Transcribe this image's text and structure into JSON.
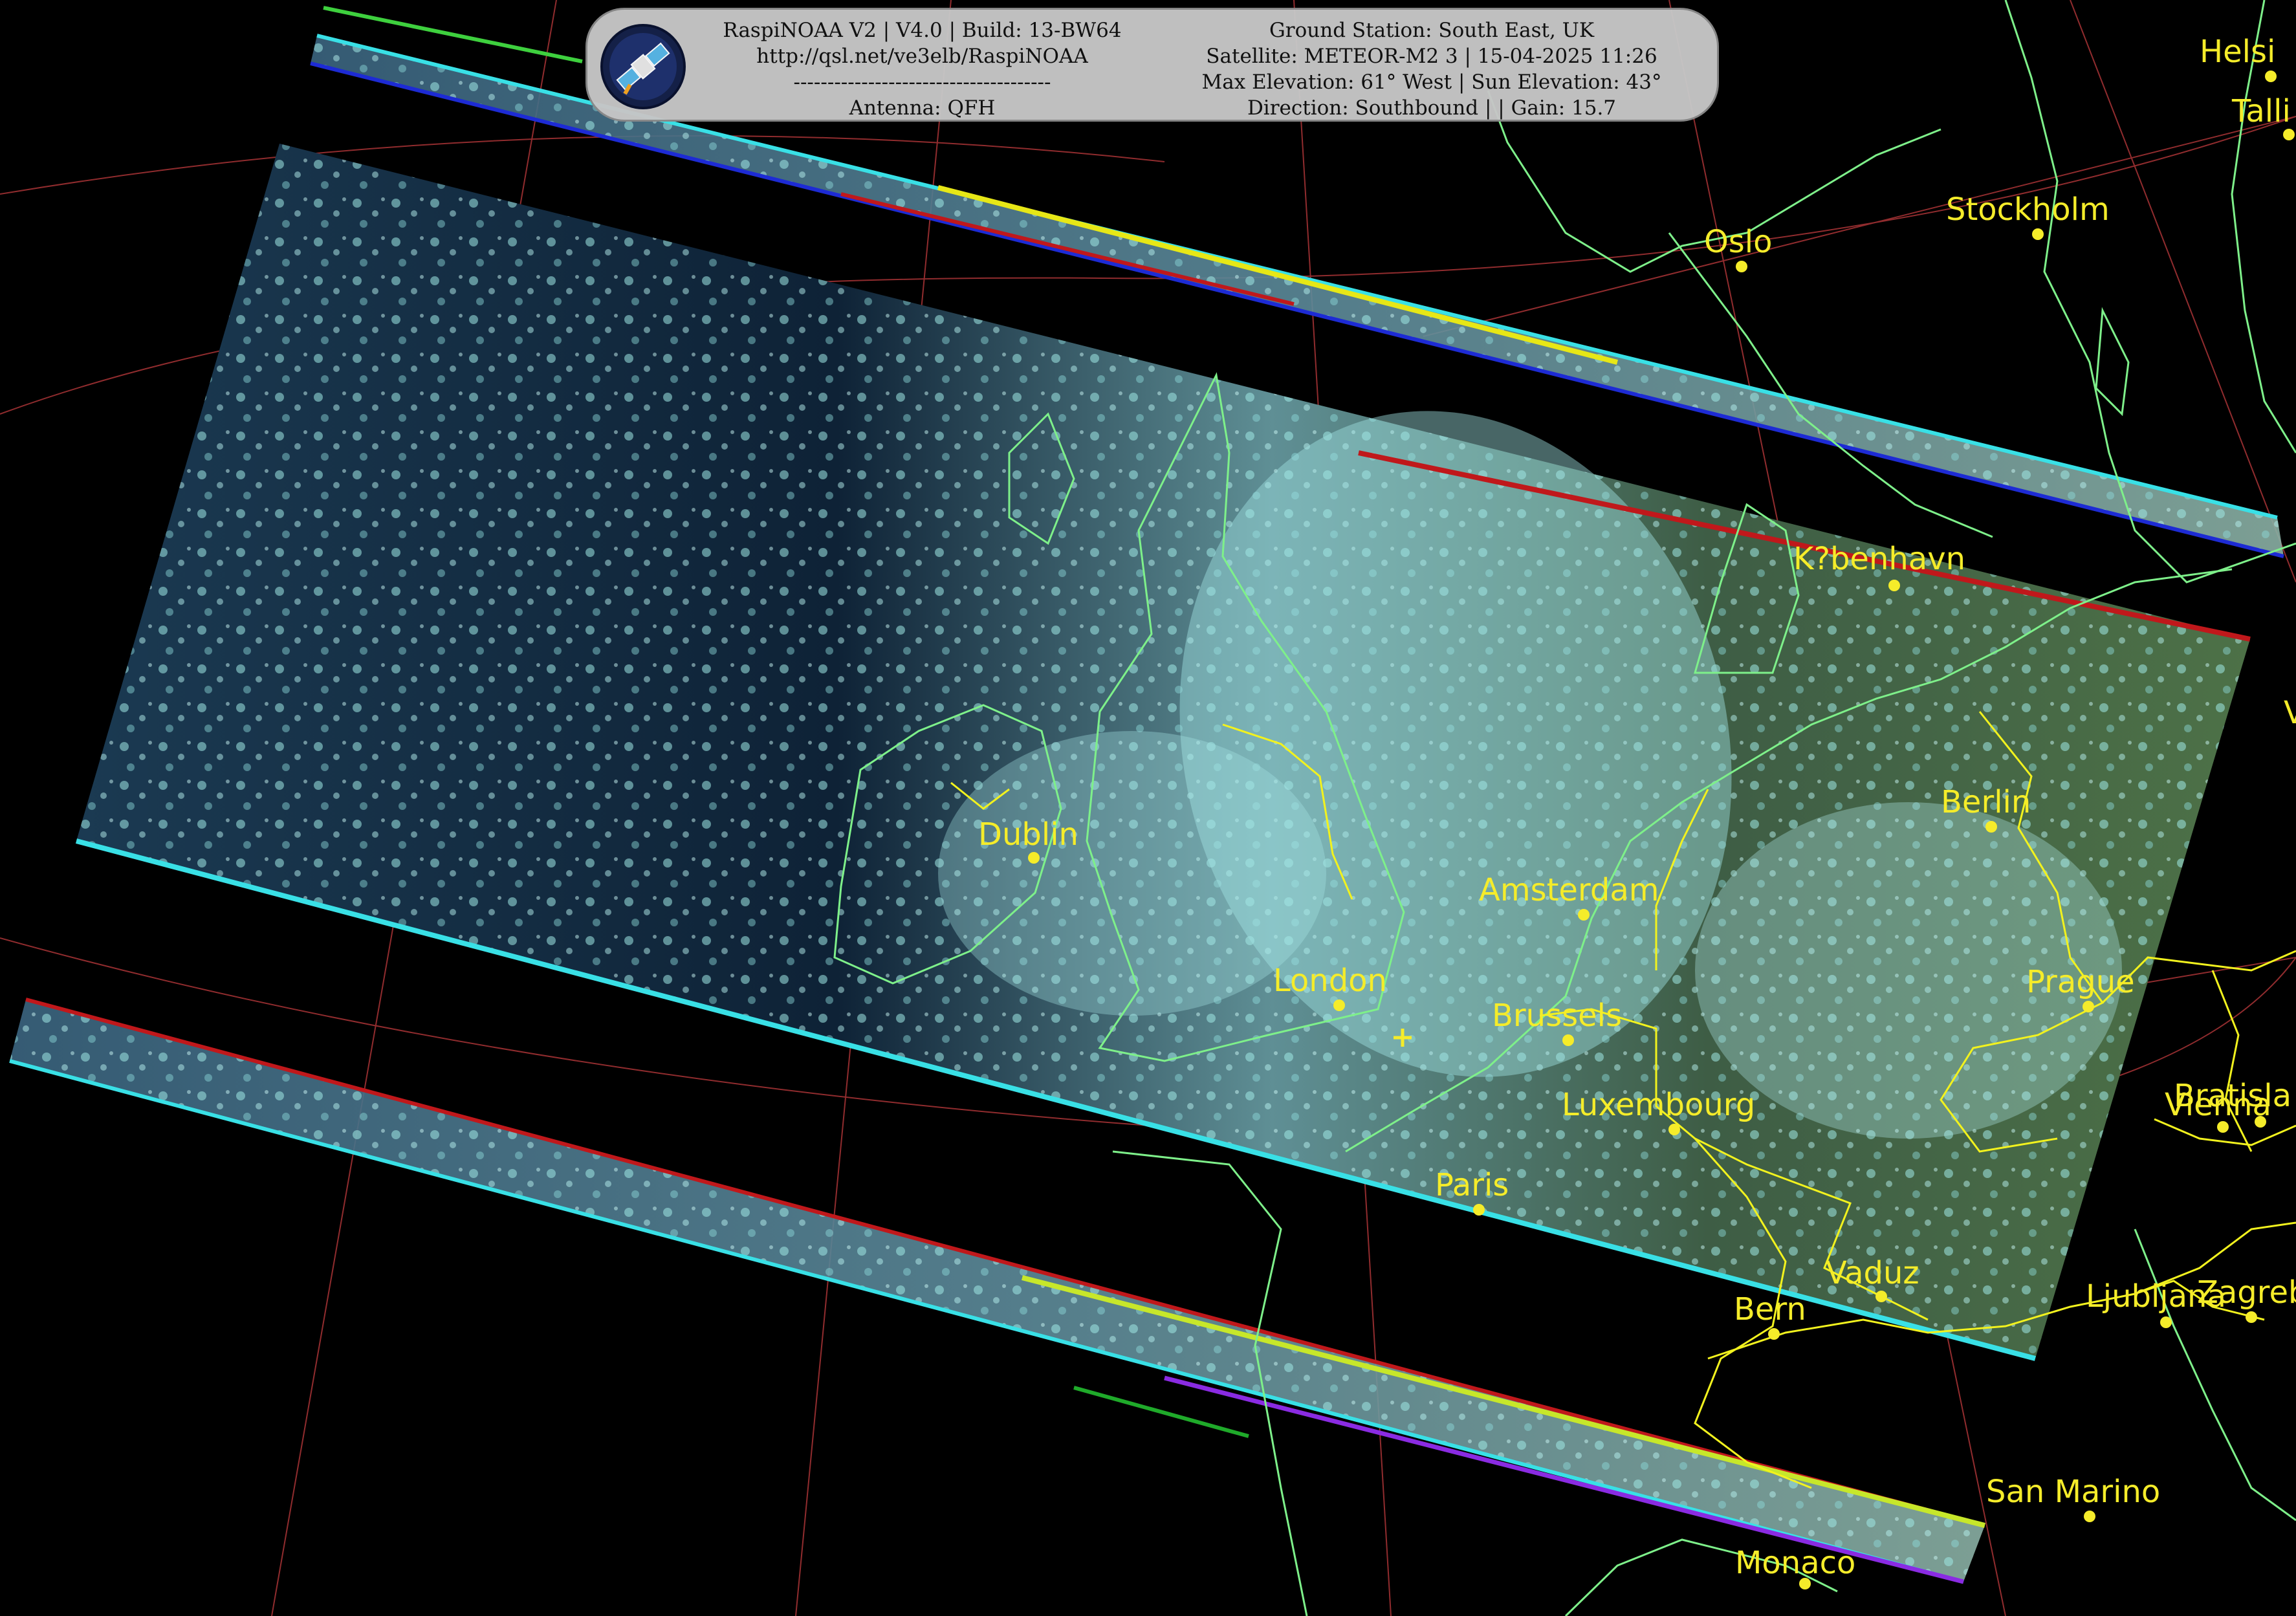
{
  "hud": {
    "left_lines": [
      "RaspiNOAA V2 | V4.0 | Build: 13-BW64",
      "http://qsl.net/ve3elb/RaspiNOAA",
      "--------------------------------------",
      "Antenna: QFH"
    ],
    "right_lines": [
      "Ground Station: South East, UK",
      "Satellite: METEOR-M2 3 | 15-04-2025 11:26",
      "Max Elevation: 61° West | Sun Elevation: 43°",
      "Direction: Southbound | | Gain: 15.7"
    ],
    "logo_icon": "satellite-icon"
  },
  "cities": [
    {
      "name": "Oslo"
    },
    {
      "name": "Stockholm"
    },
    {
      "name": "Helsi"
    },
    {
      "name": "Talli"
    },
    {
      "name": "K?benhavn"
    },
    {
      "name": "Berlin"
    },
    {
      "name": "Dublin"
    },
    {
      "name": "Amsterdam"
    },
    {
      "name": "London"
    },
    {
      "name": "Brussels"
    },
    {
      "name": "Prague"
    },
    {
      "name": "Luxembourg"
    },
    {
      "name": "Bratisla"
    },
    {
      "name": "Vienna"
    },
    {
      "name": "Paris"
    },
    {
      "name": "Vaduz"
    },
    {
      "name": "Bern"
    },
    {
      "name": "Ljubljana"
    },
    {
      "name": "Zagreb"
    },
    {
      "name": "San Marino"
    },
    {
      "name": "Monaco"
    },
    {
      "name": "V"
    }
  ],
  "colors": {
    "city": "#f5ec2a",
    "coast": "#7ef08a",
    "border": "#f2f21e",
    "graticule": "#b4373a",
    "cloud": "#8fe7e6",
    "ocean": "#0b1a2c",
    "land": "#3f6a3a"
  }
}
